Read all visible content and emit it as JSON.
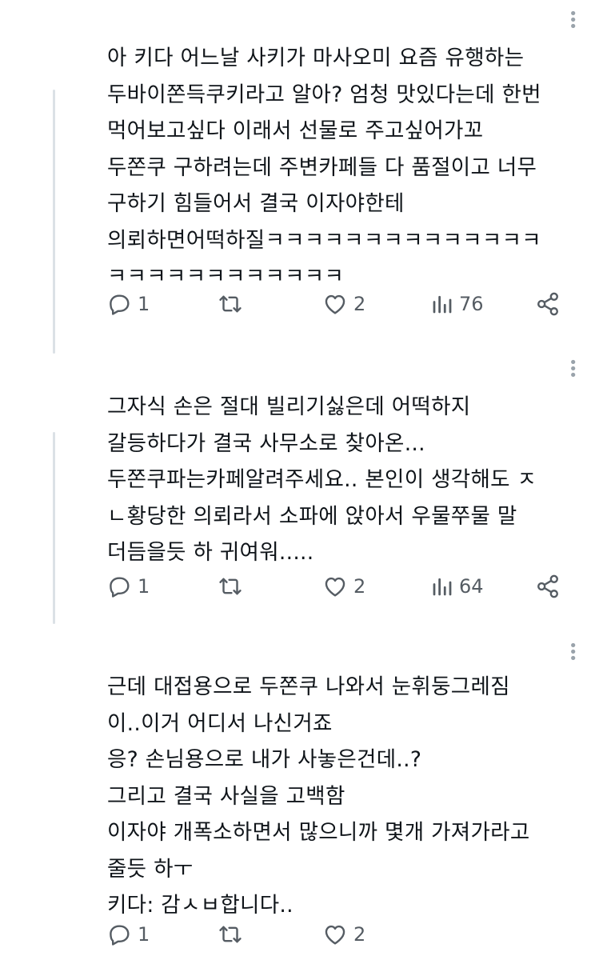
{
  "posts": [
    {
      "text": "아 키다 어느날 사키가 마사오미 요즘 유행하는\n두바이쫀득쿠키라고 알아? 엄청 맛있다는데 한번\n먹어보고싶다 이래서 선물로 주고싶어가꼬\n두쫀쿠 구하려는데 주변카페들 다 품절이고 너무\n구하기 힘들어서 결국 이자야한테\n의뢰하면어떡하질ㅋㅋㅋㅋㅋㅋㅋㅋㅋㅋㅋㅋㅋㅋ\nㅋㅋㅋㅋㅋㅋㅋㅋㅋㅋㅋㅋ",
      "replies": "1",
      "retweets": "",
      "likes": "2",
      "views": "76"
    },
    {
      "text": "그자식 손은 절대 빌리기싫은데 어떡하지\n갈등하다가 결국 사무소로 찾아온...\n두쫀쿠파는카페알려주세요.. 본인이 생각해도 ㅈ\nㄴ황당한 의뢰라서 소파에 앉아서 우물쭈물 말\n더듬을듯 하 귀여워.....",
      "replies": "1",
      "retweets": "",
      "likes": "2",
      "views": "64"
    },
    {
      "text": "근데 대접용으로 두쫀쿠 나와서 눈휘둥그레짐\n이..이거 어디서 나신거죠\n응? 손님용으로 내가 사놓은건데..?\n그리고 결국 사실을 고백함\n이자야 개폭소하면서 많으니까 몇개 가져가라고\n줄듯 하ㅜ\n키다: 감ㅅㅂ합니다..",
      "replies": "1",
      "retweets": "",
      "likes": "2",
      "views": ""
    }
  ],
  "icons": [
    "reply-icon",
    "retweet-icon",
    "like-icon",
    "views-icon",
    "share-icon",
    "more-icon"
  ],
  "colors": {
    "text": "#0f1419",
    "icon": "#555c63",
    "thread_line": "#dbe1e6",
    "more": "#9aa3ab"
  }
}
